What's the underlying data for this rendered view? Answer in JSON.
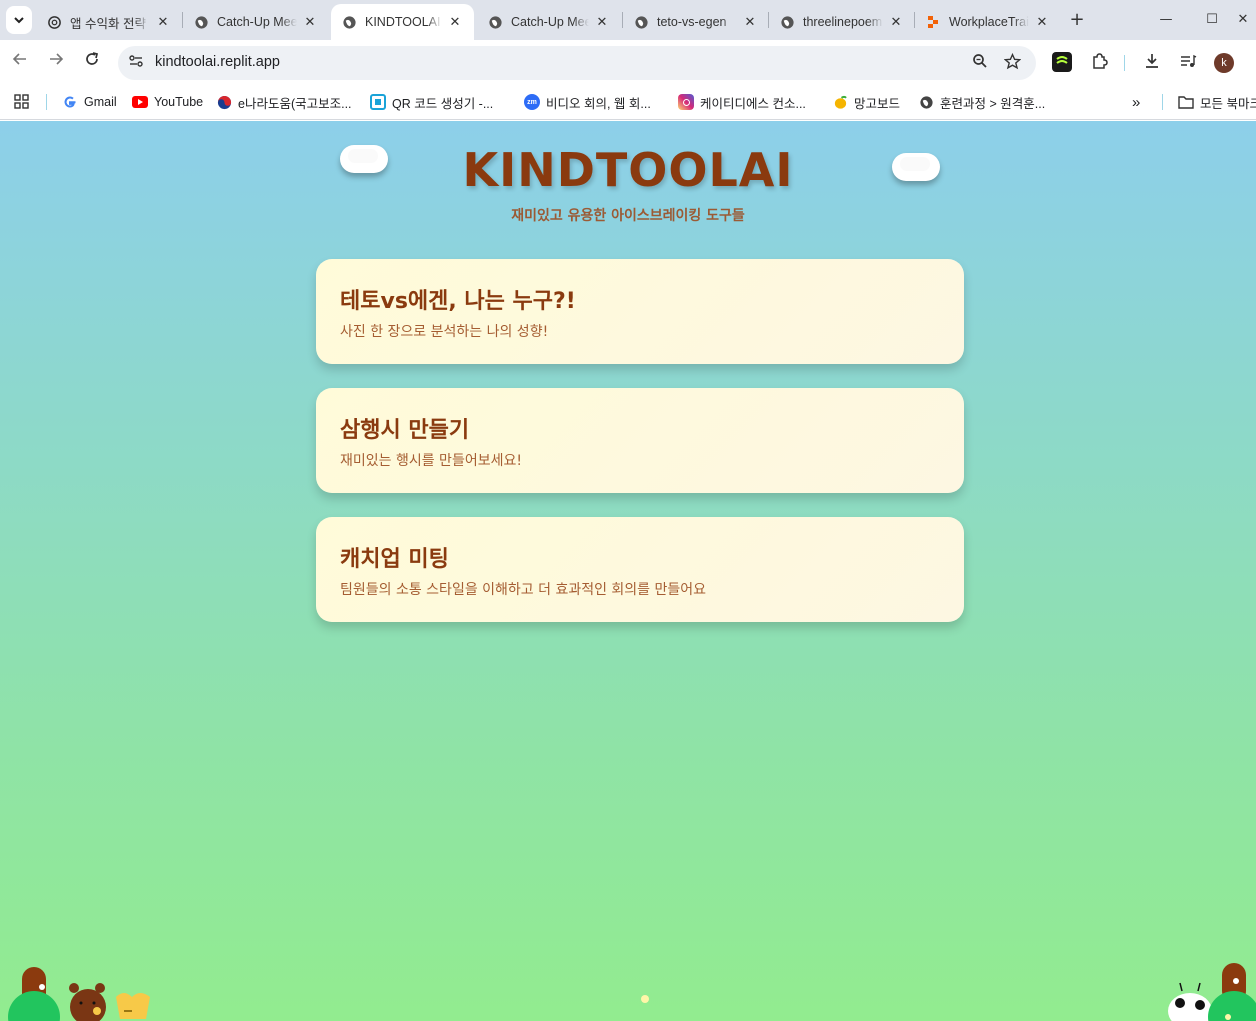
{
  "browser": {
    "tabs": [
      {
        "title": "앱 수익화 전략",
        "icon": "openai",
        "active": false
      },
      {
        "title": "Catch-Up Meeting",
        "icon": "globe",
        "active": false
      },
      {
        "title": "KINDTOOLAI",
        "icon": "globe",
        "active": true
      },
      {
        "title": "Catch-Up Meeting",
        "icon": "globe",
        "active": false
      },
      {
        "title": "teto-vs-egen",
        "icon": "globe",
        "active": false
      },
      {
        "title": "threelinepoem",
        "icon": "globe",
        "active": false
      },
      {
        "title": "WorkplaceTrain",
        "icon": "replit",
        "active": false
      }
    ],
    "tab_search_glyph": "⌄",
    "new_tab_glyph": "+",
    "close_glyph": "✕",
    "window_controls": {
      "minimize": "—",
      "maximize": "☐",
      "close": "✕"
    },
    "address": {
      "url": "kindtoolai.replit.app"
    },
    "profile_initial": "k",
    "bookmarks": [
      {
        "label": "Gmail",
        "icon": "google",
        "color": "#ffffff"
      },
      {
        "label": "YouTube",
        "icon": "youtube",
        "color": "#ff0000"
      },
      {
        "label": "e나라도움(국고보조...",
        "icon": "korea",
        "color": "#1a3c8f"
      },
      {
        "label": "QR 코드 생성기 -...",
        "icon": "qr",
        "color": "#1aa3d8"
      },
      {
        "label": "비디오 회의, 웹 회...",
        "icon": "zoom",
        "color": "#2d6cf6"
      },
      {
        "label": "케이티디에스 컨소...",
        "icon": "instagram",
        "color": "#d6249f"
      },
      {
        "label": "망고보드",
        "icon": "mango",
        "color": "#f5b400"
      },
      {
        "label": "훈련과정 > 원격훈...",
        "icon": "globe",
        "color": "#444444"
      }
    ],
    "bookmarks_more": "»",
    "all_bookmarks": "모든 북마크"
  },
  "page": {
    "title": "KINDTOOLAI",
    "subtitle": "재미있고 유용한 아이스브레이킹 도구들",
    "cards": [
      {
        "title": "테토vs에겐, 나는 누구?!",
        "desc": "사진 한 장으로 분석하는 나의 성향!"
      },
      {
        "title": "삼행시 만들기",
        "desc": "재미있는 행시를 만들어보세요!"
      },
      {
        "title": "캐치업 미팅",
        "desc": "팀원들의 소통 스타일을 이해하고 더 효과적인 회의를 만들어요"
      }
    ],
    "colors": {
      "title": "#8a3a0f",
      "card_bg": "#fffbd9",
      "desc": "#a55d32"
    }
  }
}
